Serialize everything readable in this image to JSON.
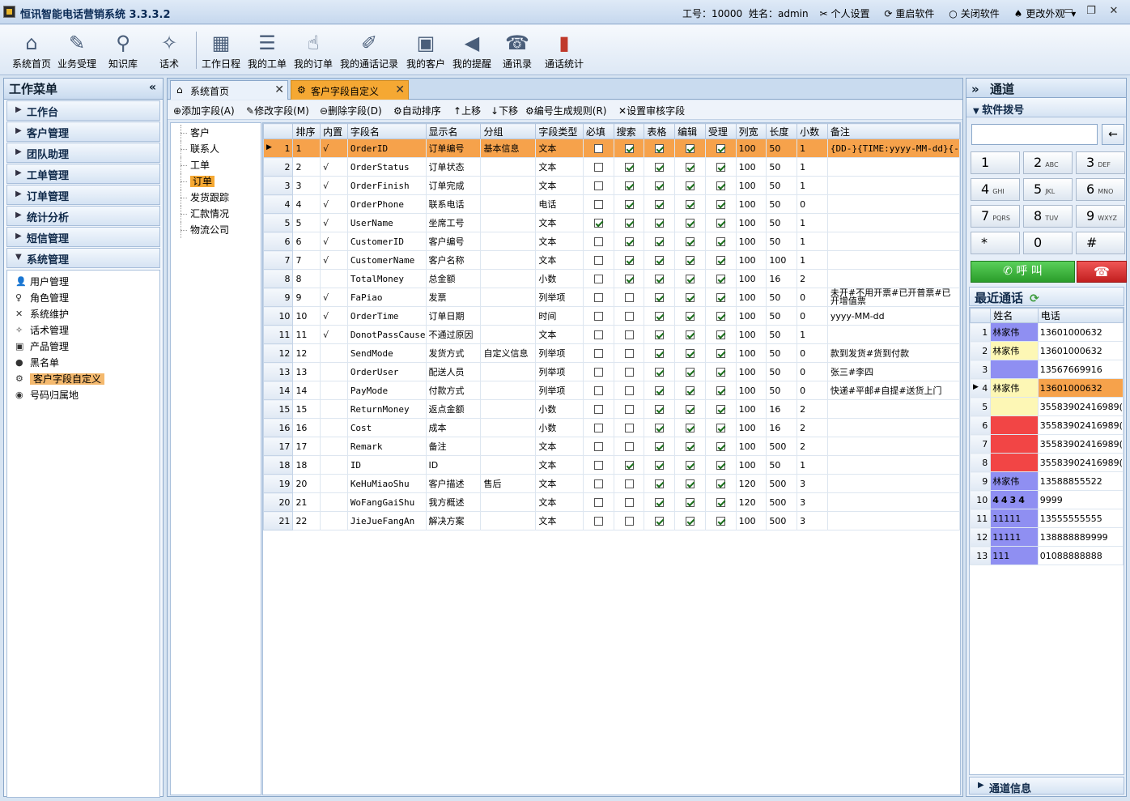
{
  "app": {
    "title": "恒讯智能电话营销系统 3.3.3.2",
    "employee_id": "工号：10000",
    "user_name": "姓名：admin",
    "links": [
      "个人设置",
      "重启软件",
      "关闭软件",
      "更改外观"
    ]
  },
  "toolbar": [
    {
      "label": "系统首页",
      "icon": "home-icon"
    },
    {
      "label": "业务受理",
      "icon": "edit-icon"
    },
    {
      "label": "知识库",
      "icon": "knowledge-icon"
    },
    {
      "label": "话术",
      "icon": "script-icon"
    },
    {
      "label": "工作日程",
      "icon": "calendar-icon"
    },
    {
      "label": "我的工单",
      "icon": "workorder-icon"
    },
    {
      "label": "我的订单",
      "icon": "order-icon"
    },
    {
      "label": "我的通话记录",
      "icon": "call-record-icon"
    },
    {
      "label": "我的客户",
      "icon": "customer-card-icon"
    },
    {
      "label": "我的提醒",
      "icon": "speaker-icon"
    },
    {
      "label": "通讯录",
      "icon": "contacts-icon"
    },
    {
      "label": "通话统计",
      "icon": "bar-chart-icon"
    }
  ],
  "left_menu": {
    "title": "工作菜单",
    "collapse": "«",
    "sections": [
      "工作台",
      "客户管理",
      "团队助理",
      "工单管理",
      "订单管理",
      "统计分析",
      "短信管理",
      "系统管理"
    ],
    "sub_items": [
      {
        "label": "用户管理",
        "icon": "user-icon"
      },
      {
        "label": "角色管理",
        "icon": "role-icon"
      },
      {
        "label": "系统维护",
        "icon": "tools-icon"
      },
      {
        "label": "话术管理",
        "icon": "script-icon"
      },
      {
        "label": "产品管理",
        "icon": "box-icon"
      },
      {
        "label": "黑名单",
        "icon": "blacklist-icon"
      },
      {
        "label": "客户字段自定义",
        "icon": "gear-icon"
      },
      {
        "label": "号码归属地",
        "icon": "globe-icon"
      }
    ]
  },
  "tabs": [
    {
      "label": "系统首页"
    },
    {
      "label": "客户字段自定义"
    }
  ],
  "actions": [
    {
      "label": "添加字段(A)",
      "icon": "add-icon"
    },
    {
      "label": "修改字段(M)",
      "icon": "edit-icon"
    },
    {
      "label": "删除字段(D)",
      "icon": "delete-icon"
    },
    {
      "label": "自动排序",
      "icon": "sort-icon"
    },
    {
      "label": "上移",
      "icon": "arrow-up-icon"
    },
    {
      "label": "下移",
      "icon": "arrow-down-icon"
    },
    {
      "label": "编号生成规则(R)",
      "icon": "gear-icon"
    },
    {
      "label": "设置审核字段",
      "icon": "tools-icon"
    }
  ],
  "categories": [
    "客户",
    "联系人",
    "工单",
    "订单",
    "发货跟踪",
    "汇款情况",
    "物流公司"
  ],
  "grid": {
    "columns": [
      "排序",
      "内置",
      "字段名",
      "显示名",
      "分组",
      "字段类型",
      "必填",
      "搜索",
      "表格",
      "编辑",
      "受理",
      "列宽",
      "长度",
      "小数",
      "备注"
    ],
    "rows": [
      {
        "n": "1",
        "sort": "1",
        "builtin": "√",
        "field": "OrderID",
        "display": "订单编号",
        "group": "基本信息",
        "type": "文本",
        "req": false,
        "search": true,
        "table": true,
        "edit": true,
        "accept": true,
        "width": "100",
        "len": "50",
        "dec": "1",
        "note": "{DD-}{TIME:yyyy-MM-dd}{-"
      },
      {
        "n": "2",
        "sort": "2",
        "builtin": "√",
        "field": "OrderStatus",
        "display": "订单状态",
        "group": "",
        "type": "文本",
        "req": false,
        "search": true,
        "table": true,
        "edit": true,
        "accept": true,
        "width": "100",
        "len": "50",
        "dec": "1",
        "note": ""
      },
      {
        "n": "3",
        "sort": "3",
        "builtin": "√",
        "field": "OrderFinish",
        "display": "订单完成",
        "group": "",
        "type": "文本",
        "req": false,
        "search": true,
        "table": true,
        "edit": true,
        "accept": true,
        "width": "100",
        "len": "50",
        "dec": "1",
        "note": ""
      },
      {
        "n": "4",
        "sort": "4",
        "builtin": "√",
        "field": "OrderPhone",
        "display": "联系电话",
        "group": "",
        "type": "电话",
        "req": false,
        "search": true,
        "table": true,
        "edit": true,
        "accept": true,
        "width": "100",
        "len": "50",
        "dec": "0",
        "note": ""
      },
      {
        "n": "5",
        "sort": "5",
        "builtin": "√",
        "field": "UserName",
        "display": "坐席工号",
        "group": "",
        "type": "文本",
        "req": true,
        "search": true,
        "table": true,
        "edit": true,
        "accept": true,
        "width": "100",
        "len": "50",
        "dec": "1",
        "note": ""
      },
      {
        "n": "6",
        "sort": "6",
        "builtin": "√",
        "field": "CustomerID",
        "display": "客户编号",
        "group": "",
        "type": "文本",
        "req": false,
        "search": true,
        "table": true,
        "edit": true,
        "accept": true,
        "width": "100",
        "len": "50",
        "dec": "1",
        "note": ""
      },
      {
        "n": "7",
        "sort": "7",
        "builtin": "√",
        "field": "CustomerName",
        "display": "客户名称",
        "group": "",
        "type": "文本",
        "req": false,
        "search": true,
        "table": true,
        "edit": true,
        "accept": true,
        "width": "100",
        "len": "100",
        "dec": "1",
        "note": ""
      },
      {
        "n": "8",
        "sort": "8",
        "builtin": "",
        "field": "TotalMoney",
        "display": "总金额",
        "group": "",
        "type": "小数",
        "req": false,
        "search": true,
        "table": true,
        "edit": true,
        "accept": true,
        "width": "100",
        "len": "16",
        "dec": "2",
        "note": ""
      },
      {
        "n": "9",
        "sort": "9",
        "builtin": "√",
        "field": "FaPiao",
        "display": "发票",
        "group": "",
        "type": "列举项",
        "req": false,
        "search": false,
        "table": true,
        "edit": true,
        "accept": true,
        "width": "100",
        "len": "50",
        "dec": "0",
        "note": "未开#不用开票#已开普票#已开增值票"
      },
      {
        "n": "10",
        "sort": "10",
        "builtin": "√",
        "field": "OrderTime",
        "display": "订单日期",
        "group": "",
        "type": "时间",
        "req": false,
        "search": false,
        "table": true,
        "edit": true,
        "accept": true,
        "width": "100",
        "len": "50",
        "dec": "0",
        "note": "yyyy-MM-dd"
      },
      {
        "n": "11",
        "sort": "11",
        "builtin": "√",
        "field": "DonotPassCause",
        "display": "不通过原因",
        "group": "",
        "type": "文本",
        "req": false,
        "search": false,
        "table": true,
        "edit": true,
        "accept": true,
        "width": "100",
        "len": "50",
        "dec": "1",
        "note": ""
      },
      {
        "n": "12",
        "sort": "12",
        "builtin": "",
        "field": "SendMode",
        "display": "发货方式",
        "group": "自定义信息",
        "type": "列举项",
        "req": false,
        "search": false,
        "table": true,
        "edit": true,
        "accept": true,
        "width": "100",
        "len": "50",
        "dec": "0",
        "note": "款到发货#货到付款"
      },
      {
        "n": "13",
        "sort": "13",
        "builtin": "",
        "field": "OrderUser",
        "display": "配送人员",
        "group": "",
        "type": "列举项",
        "req": false,
        "search": false,
        "table": true,
        "edit": true,
        "accept": true,
        "width": "100",
        "len": "50",
        "dec": "0",
        "note": "张三#李四"
      },
      {
        "n": "14",
        "sort": "14",
        "builtin": "",
        "field": "PayMode",
        "display": "付款方式",
        "group": "",
        "type": "列举项",
        "req": false,
        "search": false,
        "table": true,
        "edit": true,
        "accept": true,
        "width": "100",
        "len": "50",
        "dec": "0",
        "note": "快递#平邮#自提#送货上门"
      },
      {
        "n": "15",
        "sort": "15",
        "builtin": "",
        "field": "ReturnMoney",
        "display": "返点金额",
        "group": "",
        "type": "小数",
        "req": false,
        "search": false,
        "table": true,
        "edit": true,
        "accept": true,
        "width": "100",
        "len": "16",
        "dec": "2",
        "note": ""
      },
      {
        "n": "16",
        "sort": "16",
        "builtin": "",
        "field": "Cost",
        "display": "成本",
        "group": "",
        "type": "小数",
        "req": false,
        "search": false,
        "table": true,
        "edit": true,
        "accept": true,
        "width": "100",
        "len": "16",
        "dec": "2",
        "note": ""
      },
      {
        "n": "17",
        "sort": "17",
        "builtin": "",
        "field": "Remark",
        "display": "备注",
        "group": "",
        "type": "文本",
        "req": false,
        "search": false,
        "table": true,
        "edit": true,
        "accept": true,
        "width": "100",
        "len": "500",
        "dec": "2",
        "note": ""
      },
      {
        "n": "18",
        "sort": "18",
        "builtin": "",
        "field": "ID",
        "display": "ID",
        "group": "",
        "type": "文本",
        "req": false,
        "search": true,
        "table": true,
        "edit": true,
        "accept": true,
        "width": "100",
        "len": "50",
        "dec": "1",
        "note": ""
      },
      {
        "n": "19",
        "sort": "20",
        "builtin": "",
        "field": "KeHuMiaoShu",
        "display": "客户描述",
        "group": "售后",
        "type": "文本",
        "req": false,
        "search": false,
        "table": true,
        "edit": true,
        "accept": true,
        "width": "120",
        "len": "500",
        "dec": "3",
        "note": ""
      },
      {
        "n": "20",
        "sort": "21",
        "builtin": "",
        "field": "WoFangGaiShu",
        "display": "我方概述",
        "group": "",
        "type": "文本",
        "req": false,
        "search": false,
        "table": true,
        "edit": true,
        "accept": true,
        "width": "120",
        "len": "500",
        "dec": "3",
        "note": ""
      },
      {
        "n": "21",
        "sort": "22",
        "builtin": "",
        "field": "JieJueFangAn",
        "display": "解决方案",
        "group": "",
        "type": "文本",
        "req": false,
        "search": false,
        "table": true,
        "edit": true,
        "accept": true,
        "width": "100",
        "len": "500",
        "dec": "3",
        "note": ""
      }
    ]
  },
  "right_panel": {
    "title": "通道",
    "expand": "»",
    "dial_header": "软件拨号",
    "back": "←",
    "keys": [
      {
        "d": "1",
        "l": ""
      },
      {
        "d": "2",
        "l": "ABC"
      },
      {
        "d": "3",
        "l": "DEF"
      },
      {
        "d": "4",
        "l": "GHI"
      },
      {
        "d": "5",
        "l": "JKL"
      },
      {
        "d": "6",
        "l": "MNO"
      },
      {
        "d": "7",
        "l": "PQRS"
      },
      {
        "d": "8",
        "l": "TUV"
      },
      {
        "d": "9",
        "l": "WXYZ"
      },
      {
        "d": "*",
        "l": ""
      },
      {
        "d": "0",
        "l": ""
      },
      {
        "d": "#",
        "l": ""
      }
    ],
    "call_label": "呼 叫",
    "hangup_label": "☎",
    "recent_title": "最近通话",
    "recent_cols": [
      "姓名",
      "电话"
    ],
    "recent_rows": [
      {
        "n": "1",
        "name": "林家伟",
        "phone": "13601000632",
        "nc": "#8f8ff2",
        "pc": "#ffffff"
      },
      {
        "n": "2",
        "name": "林家伟",
        "phone": "13601000632",
        "nc": "#fdf7b5",
        "pc": "#ffffff"
      },
      {
        "n": "3",
        "name": "",
        "phone": "13567669916",
        "nc": "#8f8ff2",
        "pc": "#ffffff"
      },
      {
        "n": "4",
        "name": "林家伟",
        "phone": "13601000632",
        "nc": "#fdf7b5",
        "pc": "#f6a24b"
      },
      {
        "n": "5",
        "name": "",
        "phone": "35583902416989(",
        "nc": "#fdf7b5",
        "pc": "#ffffff"
      },
      {
        "n": "6",
        "name": "",
        "phone": "35583902416989(",
        "nc": "#f24545",
        "pc": "#ffffff"
      },
      {
        "n": "7",
        "name": "",
        "phone": "35583902416989(",
        "nc": "#f24545",
        "pc": "#ffffff"
      },
      {
        "n": "8",
        "name": "",
        "phone": "35583902416989(",
        "nc": "#f24545",
        "pc": "#ffffff"
      },
      {
        "n": "9",
        "name": "林家伟",
        "phone": "13588855522",
        "nc": "#8f8ff2",
        "pc": "#ffffff"
      },
      {
        "n": "10",
        "name": "4434",
        "phone": "9999",
        "nc": "#8f8ff2",
        "pc": "#ffffff"
      },
      {
        "n": "11",
        "name": "11111",
        "phone": "13555555555",
        "nc": "#8f8ff2",
        "pc": "#ffffff"
      },
      {
        "n": "12",
        "name": "11111",
        "phone": "138888889999",
        "nc": "#8f8ff2",
        "pc": "#ffffff"
      },
      {
        "n": "13",
        "name": "111",
        "phone": "01088888888",
        "nc": "#8f8ff2",
        "pc": "#ffffff"
      }
    ],
    "channel_info": "通道信息"
  }
}
